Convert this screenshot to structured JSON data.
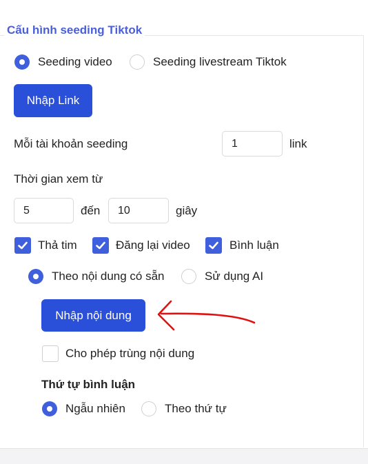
{
  "panel": {
    "title": "Cấu hình seeding Tiktok"
  },
  "mode": {
    "options": [
      {
        "label": "Seeding video",
        "selected": true
      },
      {
        "label": "Seeding livestream Tiktok",
        "selected": false
      }
    ]
  },
  "import_link_button": "Nhập Link",
  "per_account": {
    "label": "Mỗi tài khoản seeding",
    "value": "1",
    "unit": "link"
  },
  "watch_time": {
    "label": "Thời gian xem từ",
    "from": "5",
    "to_label": "đến",
    "to": "10",
    "unit": "giây"
  },
  "actions": [
    {
      "label": "Thả tim",
      "checked": true
    },
    {
      "label": "Đăng lại video",
      "checked": true
    },
    {
      "label": "Bình luận",
      "checked": true
    }
  ],
  "comment_source": {
    "options": [
      {
        "label": "Theo nội dung có sẵn",
        "selected": true
      },
      {
        "label": "Sử dụng AI",
        "selected": false
      }
    ]
  },
  "import_content_button": "Nhập nội dung",
  "allow_duplicate": {
    "label": "Cho phép trùng nội dung",
    "checked": false
  },
  "comment_order": {
    "heading": "Thứ tự bình luận",
    "options": [
      {
        "label": "Ngẫu nhiên",
        "selected": true
      },
      {
        "label": "Theo thứ tự",
        "selected": false
      }
    ]
  },
  "colors": {
    "accent": "#3f5fdc",
    "button": "#2a4fd9",
    "title": "#4a5fd8",
    "annotation": "#e01010"
  },
  "icons": [
    "check-icon",
    "red-arrow-annotation"
  ]
}
